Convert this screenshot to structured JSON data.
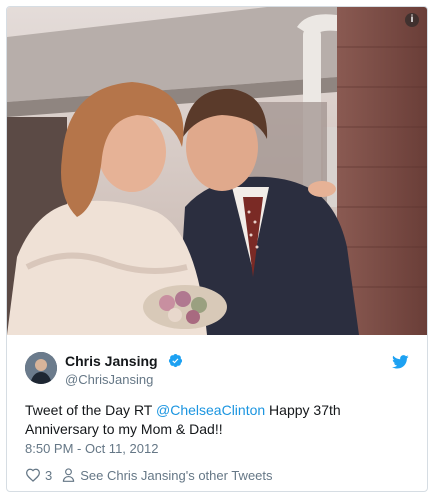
{
  "tweet": {
    "author_name": "Chris Jansing",
    "author_handle": "@ChrisJansing",
    "text_before": "Tweet of the Day RT ",
    "mention": "@ChelseaClinton",
    "text_after": " Happy 37th Anniversary to my Mom & Dad!!",
    "timestamp": "8:50 PM - Oct 11, 2012",
    "like_count": "3",
    "other_tweets_link": "See Chris Jansing's other Tweets"
  },
  "media": {
    "info_label": "i",
    "colors": {
      "sky": "#e9e6e6",
      "roof": "#b5aca8",
      "brick": "#7a4a44",
      "gutter": "#e8e4e0",
      "suit": "#2a2d3d",
      "dress": "#efe0d6",
      "hair_bride": "#b5754a",
      "hair_groom": "#5a3a2a"
    }
  },
  "icons": {
    "verified": "verified-badge-icon",
    "twitter": "twitter-bird-icon",
    "like": "heart-icon",
    "profile": "person-icon",
    "info": "info-icon"
  },
  "colors": {
    "link": "#1b95e0",
    "text": "#14171a",
    "muted": "#657786",
    "border": "#d6dde3"
  }
}
